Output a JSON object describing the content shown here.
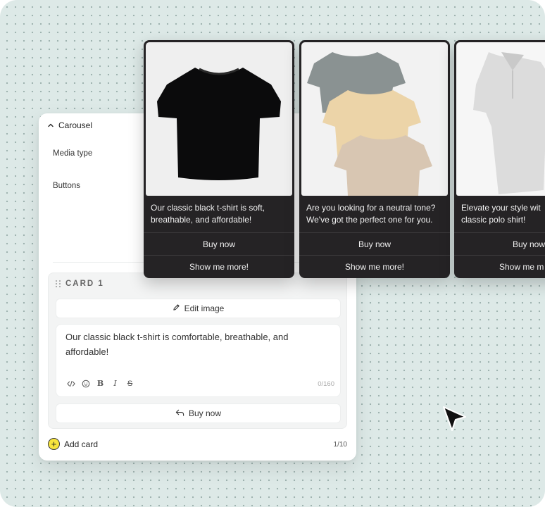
{
  "editor": {
    "section_title": "Carousel",
    "media_type_label": "Media type",
    "buttons_label": "Buttons",
    "card": {
      "title": "CARD 1",
      "edit_image_label": "Edit image",
      "message": "Our classic black t-shirt is comfortable, breathable, and affordable!",
      "char_counter": "0/160",
      "button_label": "Buy now",
      "toolbar_icons": [
        "code-icon",
        "emoji-icon",
        "bold-icon",
        "italic-icon",
        "strikethrough-icon"
      ]
    },
    "add_card_label": "Add card",
    "card_count": "1/10"
  },
  "carousel_cards": [
    {
      "line1": "Our classic black t-shirt is soft,",
      "line2": "breathable, and affordable!",
      "button1": "Buy now",
      "button2": "Show me more!"
    },
    {
      "line1": "Are you looking for a neutral tone?",
      "line2": "We've got the perfect one for you.",
      "button1": "Buy now",
      "button2": "Show me more!"
    },
    {
      "line1": "Elevate your style wit",
      "line2": "classic polo shirt!",
      "button1": "Buy now",
      "button2": "Show me m"
    }
  ],
  "colors": {
    "background": "#dde9e7",
    "card_dark": "#252325",
    "add_accent": "#f7e43d"
  }
}
